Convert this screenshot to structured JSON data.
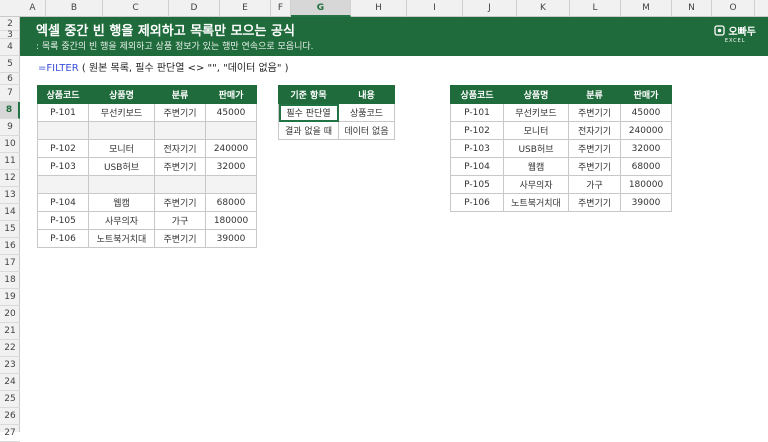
{
  "columns": [
    "A",
    "B",
    "C",
    "D",
    "E",
    "F",
    "G",
    "H",
    "I",
    "J",
    "K",
    "L",
    "M",
    "N",
    "O"
  ],
  "selected_column": "G",
  "rows": [
    "2",
    "3",
    "4",
    "5",
    "6",
    "7",
    "8",
    "9",
    "10",
    "11",
    "12",
    "13",
    "14",
    "15",
    "16",
    "17",
    "18",
    "19",
    "20",
    "21",
    "22",
    "23",
    "24",
    "25",
    "26",
    "27"
  ],
  "selected_row": "8",
  "banner": {
    "title": "엑셀 중간 빈 행을 제외하고 목록만 모으는 공식",
    "subtitle": ": 목록 중간의 빈 행을 제외하고 상품 정보가 있는 행만 연속으로 모읍니다.",
    "logo_text": "오빠두",
    "logo_sub": "EXCEL",
    "accent": "#1f6b3b"
  },
  "formula": {
    "fn": "=FILTER",
    "rest": " ( 원본 목록, 필수 판단열 <> \"\", \"데이터 없음\" )"
  },
  "source_table": {
    "headers": [
      "상품코드",
      "상품명",
      "분류",
      "판매가"
    ],
    "rows": [
      [
        "P-101",
        "무선키보드",
        "주변기기",
        "45000"
      ],
      [
        "",
        "",
        "",
        ""
      ],
      [
        "P-102",
        "모니터",
        "전자기기",
        "240000"
      ],
      [
        "P-103",
        "USB허브",
        "주변기기",
        "32000"
      ],
      [
        "",
        "",
        "",
        ""
      ],
      [
        "P-104",
        "웹캠",
        "주변기기",
        "68000"
      ],
      [
        "P-105",
        "사무의자",
        "가구",
        "180000"
      ],
      [
        "P-106",
        "노트북거치대",
        "주변기기",
        "39000"
      ]
    ]
  },
  "criteria_table": {
    "headers": [
      "기준 항목",
      "내용"
    ],
    "rows": [
      [
        "필수 판단열",
        "상품코드"
      ],
      [
        "결과 없을 때",
        "데이터 없음"
      ]
    ]
  },
  "result_table": {
    "headers": [
      "상품코드",
      "상품명",
      "분류",
      "판매가"
    ],
    "rows": [
      [
        "P-101",
        "무선키보드",
        "주변기기",
        "45000"
      ],
      [
        "P-102",
        "모니터",
        "전자기기",
        "240000"
      ],
      [
        "P-103",
        "USB허브",
        "주변기기",
        "32000"
      ],
      [
        "P-104",
        "웹캠",
        "주변기기",
        "68000"
      ],
      [
        "P-105",
        "사무의자",
        "가구",
        "180000"
      ],
      [
        "P-106",
        "노트북거치대",
        "주변기기",
        "39000"
      ]
    ]
  }
}
